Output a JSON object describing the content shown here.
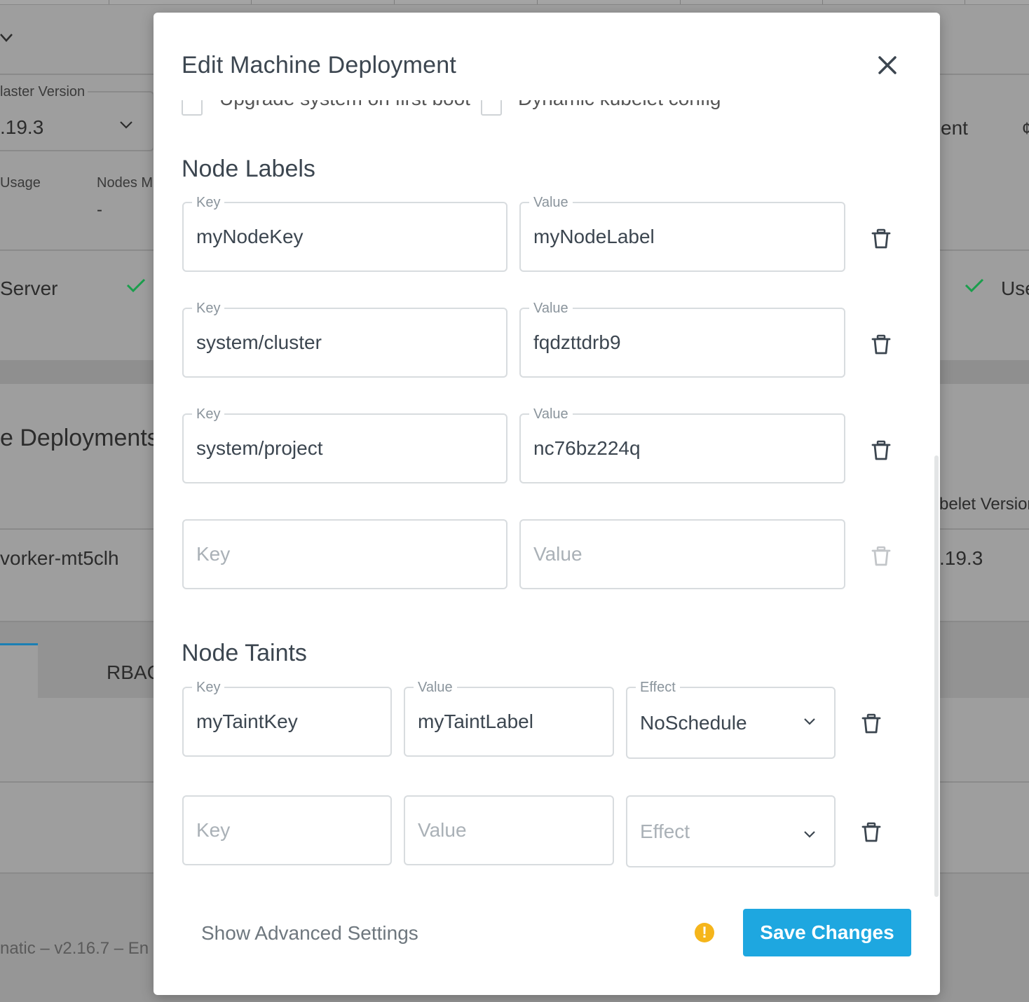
{
  "background": {
    "master_version_label": "laster Version",
    "master_version_value": ".19.3",
    "usage_label": "Usage",
    "nodes_label": "Nodes M",
    "nodes_value": "-",
    "server_label": "Server",
    "right_ent": "ent",
    "right_use": "Use",
    "deployments_title": "e Deployments",
    "kubelet_version_label": "belet Version",
    "worker_name": "vorker-mt5clh",
    "worker_version": ".19.3",
    "tab_rbac": "RBAC",
    "footer_text": "natic  –  v2.16.7  –  En"
  },
  "modal": {
    "title": "Edit Machine Deployment",
    "hidden_checkbox_1": "Upgrade system on first boot",
    "hidden_checkbox_2": "Dynamic kubelet config",
    "node_labels_title": "Node Labels",
    "node_labels": [
      {
        "key_label": "Key",
        "key": "myNodeKey",
        "value_label": "Value",
        "value": "myNodeLabel"
      },
      {
        "key_label": "Key",
        "key": "system/cluster",
        "value_label": "Value",
        "value": "fqdzttdrb9"
      },
      {
        "key_label": "Key",
        "key": "system/project",
        "value_label": "Value",
        "value": "nc76bz224q"
      }
    ],
    "empty_label": {
      "key_placeholder": "Key",
      "value_placeholder": "Value"
    },
    "node_taints_title": "Node Taints",
    "taint": {
      "key_label": "Key",
      "key": "myTaintKey",
      "value_label": "Value",
      "value": "myTaintLabel",
      "effect_label": "Effect",
      "effect": "NoSchedule"
    },
    "empty_taint": {
      "key_placeholder": "Key",
      "value_placeholder": "Value",
      "effect_placeholder": "Effect"
    },
    "advanced_link": "Show Advanced Settings",
    "save_button": "Save Changes"
  },
  "colors": {
    "accent": "#1ea7e0",
    "warning": "#f5b51b",
    "success": "#1a9e4c"
  }
}
